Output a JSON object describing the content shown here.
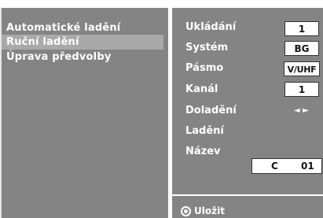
{
  "left_menu": {
    "items": [
      {
        "label": "Automatické ladění"
      },
      {
        "label": "Ruční ladění",
        "selected": true
      },
      {
        "label": "Úprava předvolby"
      }
    ]
  },
  "settings": {
    "rows": [
      {
        "label": "Ukládání",
        "value": "1"
      },
      {
        "label": "Systém",
        "value": "BG"
      },
      {
        "label": "Pásmo",
        "value": "V/UHF"
      },
      {
        "label": "Kanál",
        "value": "1"
      },
      {
        "label": "Doladění",
        "value": "◄ ►"
      },
      {
        "label": "Ladění"
      },
      {
        "label": "Název"
      }
    ],
    "name_field": {
      "prefix": "C",
      "number": "01"
    }
  },
  "footer": {
    "save_label": "Uložit",
    "icon": "ok-circle-icon"
  }
}
